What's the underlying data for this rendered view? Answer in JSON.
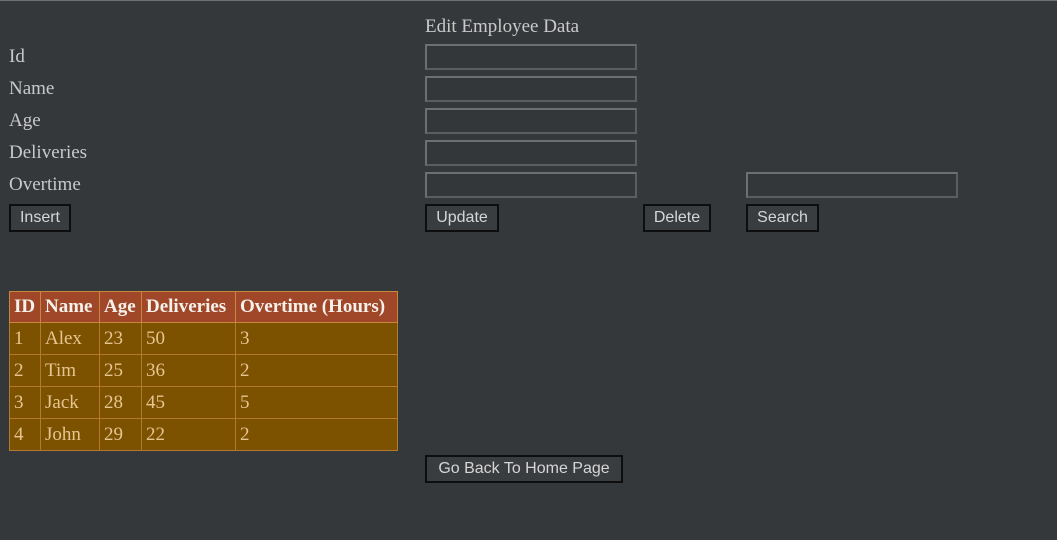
{
  "form": {
    "title": "Edit Employee Data",
    "labels": {
      "id": "Id",
      "name": "Name",
      "age": "Age",
      "deliveries": "Deliveries",
      "overtime": "Overtime"
    },
    "values": {
      "id": "",
      "name": "",
      "age": "",
      "deliveries": "",
      "overtime": "",
      "search": ""
    }
  },
  "buttons": {
    "insert": "Insert",
    "update": "Update",
    "delete": "Delete",
    "search": "Search",
    "home": "Go Back To Home Page"
  },
  "table": {
    "headers": [
      "ID",
      "Name",
      "Age",
      "Deliveries",
      "Overtime (Hours)"
    ],
    "rows": [
      [
        "1",
        "Alex",
        "23",
        "50",
        "3"
      ],
      [
        "2",
        "Tim",
        "25",
        "36",
        "2"
      ],
      [
        "3",
        "Jack",
        "28",
        "45",
        "5"
      ],
      [
        "4",
        "John",
        "29",
        "22",
        "2"
      ]
    ]
  },
  "colors": {
    "background": "#35383b",
    "table_header": "#a14729",
    "table_cell": "#7c5200"
  }
}
